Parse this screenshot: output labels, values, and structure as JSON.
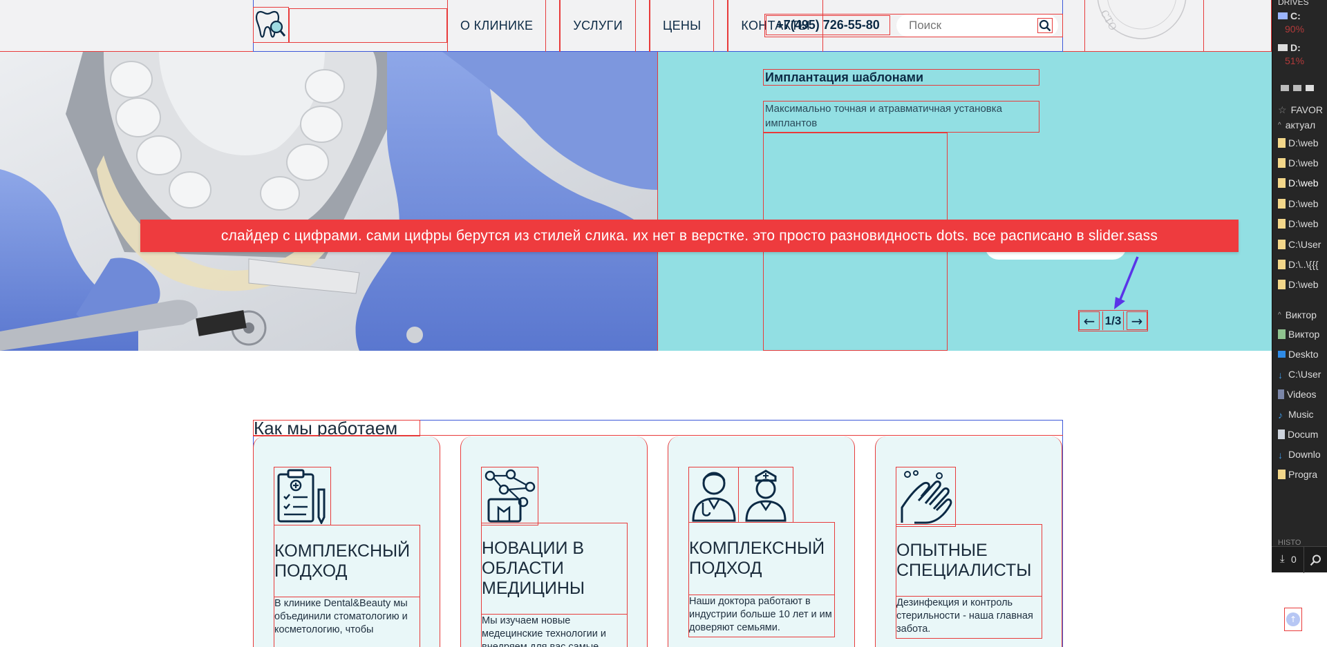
{
  "header": {
    "nav": [
      "О КЛИНИКЕ",
      "УСЛУГИ",
      "ЦЕНЫ",
      "КОНТАКТЫ"
    ],
    "phone": "+7(495) 726-55-80",
    "search_placeholder": "Поиск"
  },
  "hero": {
    "slide_title": "Имплантация шаблонами",
    "slide_text": "Максимально точная и атравматичная установка имплантов",
    "counter": "1/3",
    "prev_arrow": "←",
    "next_arrow": "→"
  },
  "note": "слайдер с цифрами. сами цифры берутся из стилей слика. их нет в верстке. это просто разновидность dots. все расписано в slider.sass",
  "section": {
    "title": "Как мы работаем",
    "cards": [
      {
        "title": "КОМПЛЕКСНЫЙ ПОДХОД",
        "text": "В клинике Dental&Beauty мы объединили стоматологию и косметологию, чтобы"
      },
      {
        "title": "НОВАЦИИ В ОБЛАСТИ МЕДИЦИНЫ",
        "text": "Мы изучаем новые медецинские технологии и внедряем для вас самые"
      },
      {
        "title": "КОМПЛЕКСНЫЙ ПОДХОД",
        "text": "Наши доктора работают в индустрии больше 10 лет и им доверяют семьями."
      },
      {
        "title": "ОПЫТНЫЕ СПЕЦИАЛИСТЫ",
        "text": "Дезинфекция и контроль стерильности - наша главная забота."
      }
    ]
  },
  "file_manager": {
    "drives_label": "DRIVES",
    "drive_c": "C:",
    "drive_c_pct": "90%",
    "drive_d": "D:",
    "drive_d_pct": "51%",
    "favorites": "FAVOR",
    "group1": "актуал",
    "items": [
      "D:\\web",
      "D:\\web",
      "D:\\web",
      "D:\\web",
      "D:\\web",
      "C:\\User",
      "D:\\..\\{{{",
      "D:\\web"
    ],
    "group2": "Виктор",
    "places": [
      "Виктор",
      "Deskto",
      "C:\\User",
      "Videos",
      "Music",
      "Docum",
      "Downlo",
      "Progra"
    ],
    "history": "HISTO",
    "download_count": "0"
  },
  "colors": {
    "outline": "#e83a3a",
    "frame": "#3b57d9",
    "panel": "#92dfe3",
    "card": "#e9f7f8",
    "note": "#ee3b3e"
  }
}
